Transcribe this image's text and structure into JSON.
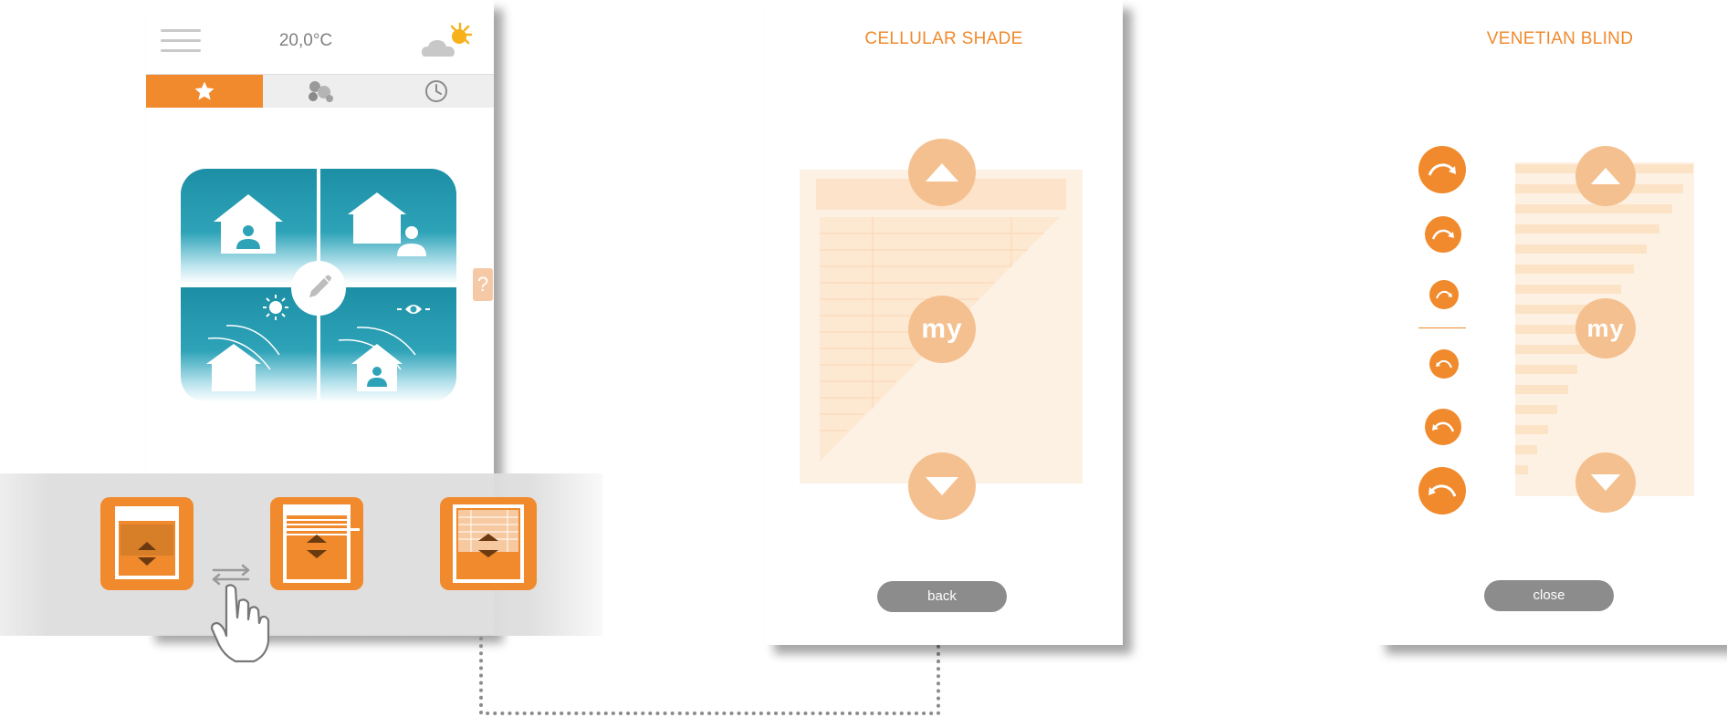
{
  "phone": {
    "temperature": "20,0°C",
    "icons": {
      "menu": "hamburger-menu-icon",
      "weather": "partly-sunny-icon",
      "help": "?"
    },
    "tabs": [
      {
        "name": "favorites",
        "icon": "star-icon",
        "active": true
      },
      {
        "name": "devices",
        "icon": "devices-group-icon",
        "active": false
      },
      {
        "name": "schedule",
        "icon": "clock-icon",
        "active": false
      }
    ],
    "scenes": [
      {
        "name": "home-present",
        "icon": "house-person-icon"
      },
      {
        "name": "away",
        "icon": "house-person-outside-icon"
      },
      {
        "name": "sun",
        "icon": "house-sun-icon"
      },
      {
        "name": "view",
        "icon": "house-eye-icon"
      }
    ]
  },
  "device_selector": {
    "items": [
      {
        "name": "roller-shade",
        "icon": "roller-shade-icon"
      },
      {
        "name": "venetian-blind",
        "icon": "venetian-blind-icon"
      },
      {
        "name": "cellular-shade",
        "icon": "cellular-shade-icon"
      }
    ]
  },
  "cellular_panel": {
    "title": "CELLULAR SHADE",
    "my_label": "my",
    "back_label": "back"
  },
  "venetian_panel": {
    "title": "VENETIAN BLIND",
    "my_label": "my",
    "close_label": "close"
  },
  "colors": {
    "accent": "#f08a2c",
    "accent_light": "#f5c08f",
    "shade_bg": "#fdf1e4",
    "tile_blue": "#1c8fa5",
    "button_gray": "#8c8c8c"
  }
}
